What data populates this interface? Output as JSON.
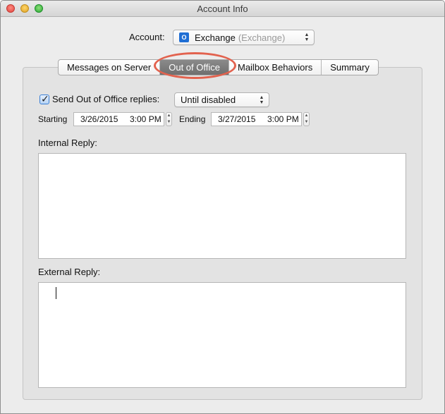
{
  "window": {
    "title": "Account Info"
  },
  "account": {
    "label": "Account:",
    "name": "Exchange",
    "type": "(Exchange)",
    "icon": "exchange-icon"
  },
  "tabs": [
    {
      "label": "Messages on Server",
      "active": false
    },
    {
      "label": "Out of Office",
      "active": true
    },
    {
      "label": "Mailbox Behaviors",
      "active": false
    },
    {
      "label": "Summary",
      "active": false
    }
  ],
  "out_of_office": {
    "send_checked": true,
    "send_label": "Send Out of Office replies:",
    "duration_value": "Until disabled",
    "starting_label": "Starting",
    "starting_date": "3/26/2015",
    "starting_time": "3:00 PM",
    "ending_label": "Ending",
    "ending_date": "3/27/2015",
    "ending_time": "3:00 PM",
    "internal_label": "Internal Reply:",
    "internal_text": "",
    "external_label": "External Reply:",
    "external_text": ""
  },
  "colors": {
    "highlight_ring": "#e2624e",
    "active_tab": "#7d7d7d",
    "checkbox": "#3b7fd6"
  }
}
